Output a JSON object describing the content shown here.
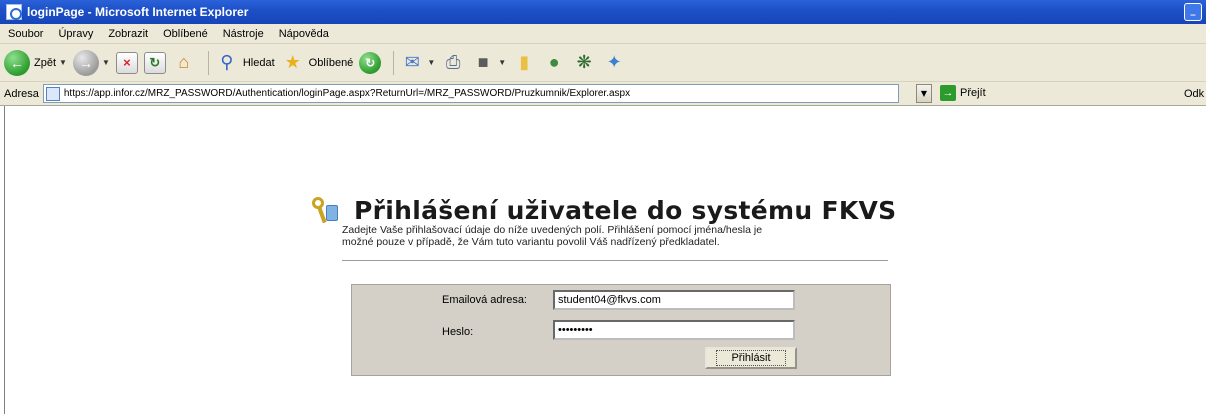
{
  "window": {
    "title": "loginPage - Microsoft Internet Explorer",
    "min_glyph": "_"
  },
  "menu": {
    "items": [
      "Soubor",
      "Úpravy",
      "Zobrazit",
      "Oblíbené",
      "Nástroje",
      "Nápověda"
    ]
  },
  "toolbar": {
    "back_label": "Zpět",
    "search_label": "Hledat",
    "favorites_label": "Oblíbené",
    "icons": [
      "back-icon",
      "forward-icon",
      "stop-icon",
      "refresh-icon",
      "home-icon",
      "search-icon",
      "favorites-icon",
      "history-icon",
      "mail-icon",
      "print-icon",
      "edit-icon",
      "folder-icon",
      "messenger-icon",
      "settings-icon",
      "discuss-icon"
    ]
  },
  "address": {
    "label": "Adresa",
    "url": "https://app.infor.cz/MRZ_PASSWORD/Authentication/loginPage.aspx?ReturnUrl=/MRZ_PASSWORD/Pruzkumnik/Explorer.aspx",
    "go_label": "Přejít",
    "links_label": "Odk"
  },
  "page": {
    "heading": "Přihlášení uživatele do systému FKVS",
    "intro_line1": "Zadejte Vaše přihlašovací údaje do níže uvedených polí. Přihlášení pomocí jména/hesla je",
    "intro_line2": "možné pouze v případě, že Vám tuto variantu povolil Váš nadřízený předkladatel."
  },
  "form": {
    "email_label": "Emailová adresa:",
    "email_value": "student04@fkvs.com",
    "password_label": "Heslo:",
    "password_value": "•••••••••",
    "submit_label": "Přihlásit"
  }
}
